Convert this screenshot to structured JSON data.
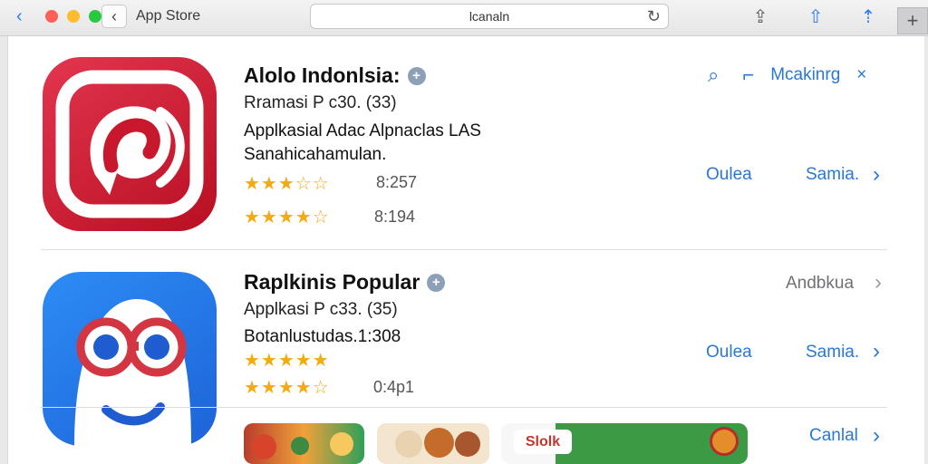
{
  "window": {
    "title": "App Store",
    "address": "lcanaln",
    "traffic_lights": [
      "#ff5f57",
      "#febc2e",
      "#28c840"
    ],
    "icons": [
      "back-arrow-icon",
      "reload-icon",
      "share-icon",
      "bookmark-icon",
      "export-icon",
      "plus-icon"
    ]
  },
  "apps": [
    {
      "name": "Alolo Indonlsia:",
      "subtitle": "Rramasi P c30. (33)",
      "description_lines": [
        "Applkasial Adac Alpnaclas LAS",
        "Sanahicahamulan."
      ],
      "rating_rows": [
        {
          "stars": "★★★☆☆",
          "score": "8:257"
        },
        {
          "stars": "★★★★☆",
          "score": "8:194"
        }
      ],
      "actions": [
        "Oulea",
        "Samia."
      ],
      "top_actions": [
        "Mcakinrg"
      ]
    },
    {
      "name": "Raplkinis Popular",
      "subtitle": "Applkasi P c33. (35)",
      "description_lines": [
        "Botanlustudas.1:308"
      ],
      "rating_rows": [
        {
          "stars": "★★★★★",
          "score": ""
        },
        {
          "stars": "★★★★☆",
          "score": "0:4p1"
        }
      ],
      "actions": [
        "Oulea",
        "Samia."
      ],
      "side_label": "Andbkua"
    }
  ],
  "preview": {
    "tag": "Slolk",
    "action": "Canlal"
  }
}
